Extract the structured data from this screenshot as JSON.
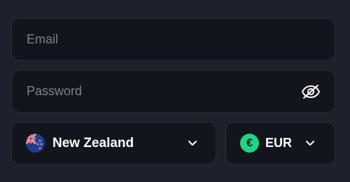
{
  "form": {
    "email": {
      "placeholder": "Email",
      "value": ""
    },
    "password": {
      "placeholder": "Password",
      "value": "",
      "toggle_icon": "eye-off-icon"
    },
    "country": {
      "selected": "New Zealand",
      "flag_icon": "new-zealand-flag-icon",
      "chevron_icon": "chevron-down-icon"
    },
    "currency": {
      "selected": "EUR",
      "symbol": "€",
      "badge_color": "#22d384",
      "chevron_icon": "chevron-down-icon"
    }
  },
  "colors": {
    "background": "#1c212c",
    "field_background": "#12151c",
    "placeholder": "#7c818c",
    "text": "#ffffff",
    "accent": "#22d384"
  }
}
